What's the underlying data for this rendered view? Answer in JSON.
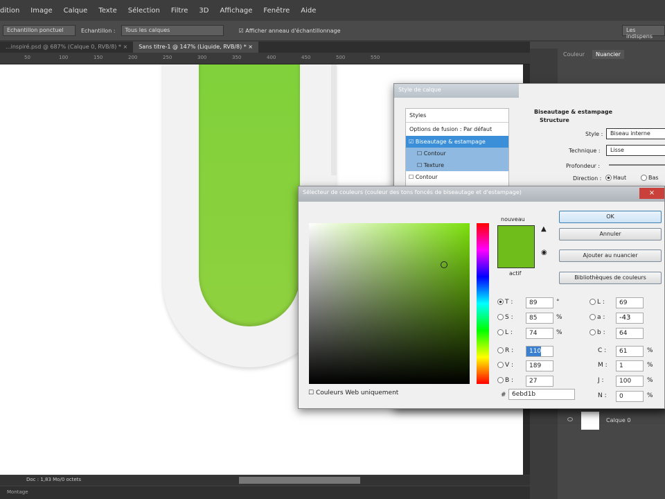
{
  "menu": [
    "dition",
    "Image",
    "Calque",
    "Texte",
    "Sélection",
    "Filtre",
    "3D",
    "Affichage",
    "Fenêtre",
    "Aide"
  ],
  "options": {
    "sample_size": "Echantillon ponctuel",
    "sample_label": "Echantillon :",
    "sample_value": "Tous les calques",
    "show_ring": "Afficher anneau d'échantillonnage",
    "essentials": "Les indispens"
  },
  "tabs": [
    "...inspiré.psd @ 687% (Calque 0, RVB/8) *",
    "Sans titre-1 @ 147% (Liquide, RVB/8) *"
  ],
  "ruler": [
    "50",
    "100",
    "150",
    "200",
    "250",
    "300",
    "350",
    "400",
    "450",
    "500",
    "550"
  ],
  "status": {
    "doc": "Doc : 1,83 Mo/0 octets",
    "montage": "Montage"
  },
  "panel": {
    "tab_color": "Couleur",
    "tab_swatches": "Nuancier",
    "layer_name": "Calque 0"
  },
  "layer_style": {
    "title": "Style de calque",
    "styles": "Styles",
    "blend": "Options de fusion : Par défaut",
    "bevel": "Biseautage & estampage",
    "contour": "Contour",
    "texture": "Texture",
    "contour2": "Contour",
    "section": "Biseautage & estampage",
    "structure": "Structure",
    "style_label": "Style :",
    "style_value": "Biseau interne",
    "technique_label": "Technique :",
    "technique_value": "Lisse",
    "depth_label": "Profondeur :",
    "direction_label": "Direction :",
    "up": "Haut",
    "down": "Bas"
  },
  "picker": {
    "title": "Sélecteur de couleurs (couleur des tons foncés de biseautage et d'estampage)",
    "new": "nouveau",
    "current": "actif",
    "ok": "OK",
    "cancel": "Annuler",
    "add_swatch": "Ajouter au nuancier",
    "libraries": "Bibliothèques de couleurs",
    "web_only": "Couleurs Web uniquement",
    "fields": {
      "T": "89",
      "S": "85",
      "L": "74",
      "R": "110",
      "V": "189",
      "B": "27",
      "Lab_L": "69",
      "a": "-43",
      "b": "64",
      "C": "61",
      "M": "1",
      "J": "100",
      "N": "0",
      "hex": "6ebd1b"
    },
    "units": {
      "deg": "°",
      "pct": "%"
    },
    "color": "#6ebd1b"
  }
}
